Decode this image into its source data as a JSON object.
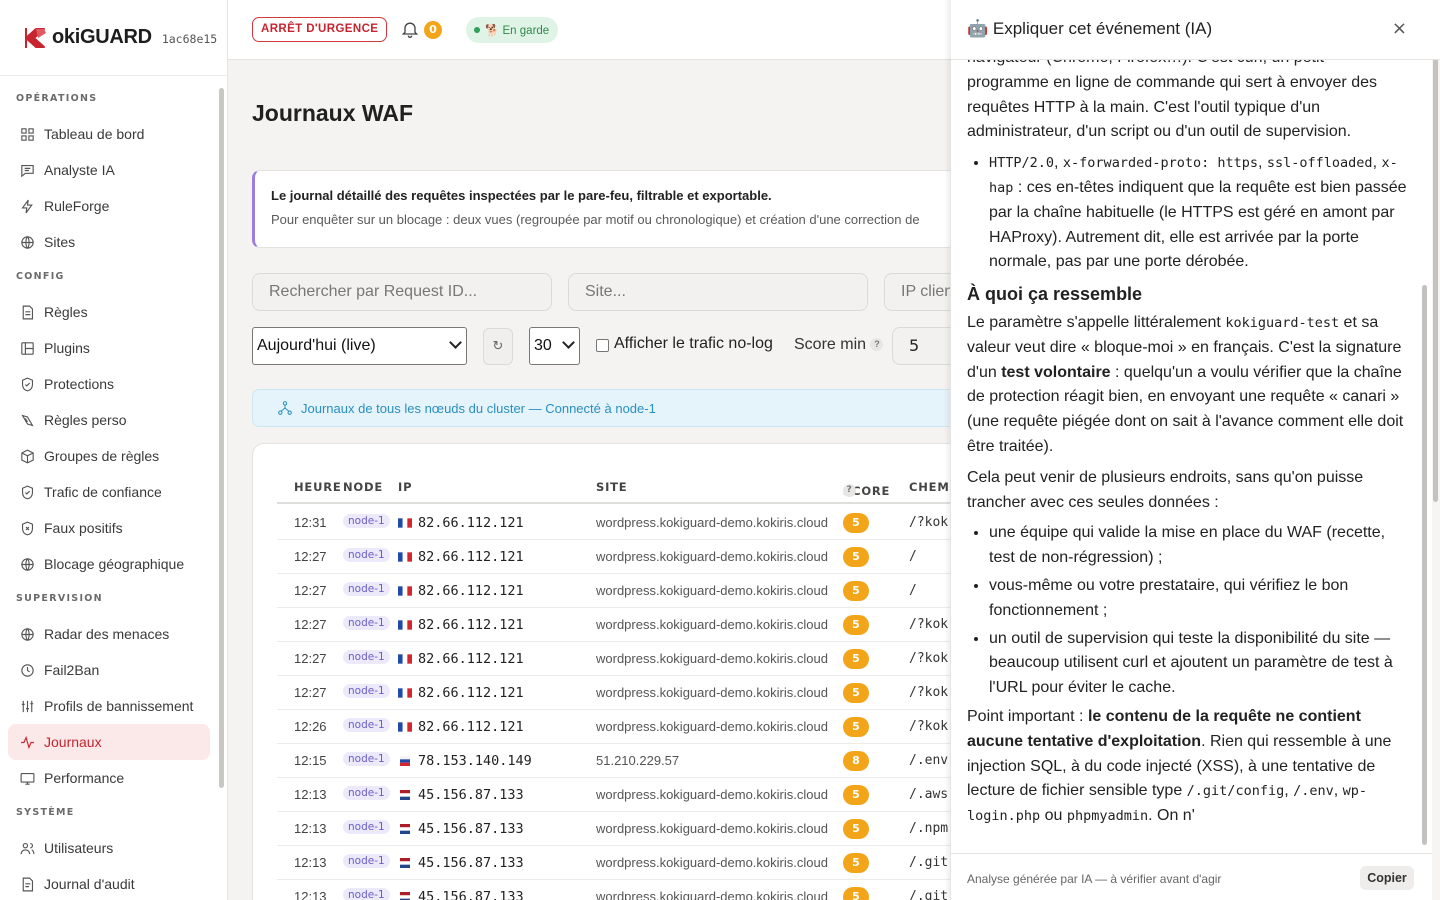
{
  "brand": {
    "name": "okiGUARD",
    "hash": "1ac68e15",
    "accent": "#c8242f"
  },
  "sidebar": {
    "sections": [
      {
        "title": "OPÉRATIONS",
        "items": [
          {
            "label": "Tableau de bord",
            "icon": "dashboard-icon"
          },
          {
            "label": "Analyste IA",
            "icon": "chat-icon"
          },
          {
            "label": "RuleForge",
            "icon": "bolt-icon"
          },
          {
            "label": "Sites",
            "icon": "globe-icon"
          }
        ]
      },
      {
        "title": "CONFIG",
        "items": [
          {
            "label": "Règles",
            "icon": "document-icon"
          },
          {
            "label": "Plugins",
            "icon": "plugin-icon"
          },
          {
            "label": "Protections",
            "icon": "shield-check-icon"
          },
          {
            "label": "Règles perso",
            "icon": "edit-rule-icon"
          },
          {
            "label": "Groupes de règles",
            "icon": "cube-icon"
          },
          {
            "label": "Trafic de confiance",
            "icon": "shield-icon"
          },
          {
            "label": "Faux positifs",
            "icon": "shield-x-icon"
          },
          {
            "label": "Blocage géographique",
            "icon": "globe-icon"
          }
        ]
      },
      {
        "title": "SUPERVISION",
        "items": [
          {
            "label": "Radar des menaces",
            "icon": "radar-icon"
          },
          {
            "label": "Fail2Ban",
            "icon": "clock-icon"
          },
          {
            "label": "Profils de bannissement",
            "icon": "sliders-icon"
          },
          {
            "label": "Journaux",
            "icon": "activity-icon",
            "active": true
          },
          {
            "label": "Performance",
            "icon": "monitor-icon"
          }
        ]
      },
      {
        "title": "SYSTÈME",
        "items": [
          {
            "label": "Utilisateurs",
            "icon": "users-icon"
          },
          {
            "label": "Journal d'audit",
            "icon": "audit-icon"
          }
        ]
      }
    ]
  },
  "topbar": {
    "emergency": "ARRÊT D'URGENCE",
    "notif_count": "0",
    "guard_status": "🐕 En garde"
  },
  "page": {
    "title": "Journaux WAF",
    "intro_title": "Le journal détaillé des requêtes inspectées par le pare-feu, filtrable et exportable.",
    "intro_text": "Pour enquêter sur un blocage : deux vues (regroupée par motif ou chronologique) et création d'une correction de",
    "filters": {
      "request_id_placeholder": "Rechercher par Request ID...",
      "site_placeholder": "Site...",
      "ip_placeholder": "IP client",
      "period": "Aujourd'hui (live)",
      "refresh": "↻",
      "limit": "30",
      "nolog_label": "Afficher le trafic no-log",
      "score_label": "Score min",
      "score_help": "?",
      "score_value": "5"
    },
    "cluster_banner": "Journaux de tous les nœuds du cluster — Connecté à node-1",
    "table": {
      "headers": {
        "time": "HEURE",
        "node": "NODE",
        "ip": "IP",
        "site": "SITE",
        "score": "SCORE",
        "path": "CHEMIN"
      },
      "rows": [
        {
          "time": "12:31",
          "node": "node-1",
          "flag": "fr",
          "ip": "82.66.112.121",
          "site": "wordpress.kokiguard-demo.kokiris.cloud",
          "score": "5",
          "path": "/?kok"
        },
        {
          "time": "12:27",
          "node": "node-1",
          "flag": "fr",
          "ip": "82.66.112.121",
          "site": "wordpress.kokiguard-demo.kokiris.cloud",
          "score": "5",
          "path": "/"
        },
        {
          "time": "12:27",
          "node": "node-1",
          "flag": "fr",
          "ip": "82.66.112.121",
          "site": "wordpress.kokiguard-demo.kokiris.cloud",
          "score": "5",
          "path": "/"
        },
        {
          "time": "12:27",
          "node": "node-1",
          "flag": "fr",
          "ip": "82.66.112.121",
          "site": "wordpress.kokiguard-demo.kokiris.cloud",
          "score": "5",
          "path": "/?kok"
        },
        {
          "time": "12:27",
          "node": "node-1",
          "flag": "fr",
          "ip": "82.66.112.121",
          "site": "wordpress.kokiguard-demo.kokiris.cloud",
          "score": "5",
          "path": "/?kok"
        },
        {
          "time": "12:27",
          "node": "node-1",
          "flag": "fr",
          "ip": "82.66.112.121",
          "site": "wordpress.kokiguard-demo.kokiris.cloud",
          "score": "5",
          "path": "/?kok"
        },
        {
          "time": "12:26",
          "node": "node-1",
          "flag": "fr",
          "ip": "82.66.112.121",
          "site": "wordpress.kokiguard-demo.kokiris.cloud",
          "score": "5",
          "path": "/?kok"
        },
        {
          "time": "12:15",
          "node": "node-1",
          "flag": "ru",
          "ip": "78.153.140.149",
          "site": "51.210.229.57",
          "score": "8",
          "path": "/.env"
        },
        {
          "time": "12:13",
          "node": "node-1",
          "flag": "nl",
          "ip": "45.156.87.133",
          "site": "wordpress.kokiguard-demo.kokiris.cloud",
          "score": "5",
          "path": "/.aws"
        },
        {
          "time": "12:13",
          "node": "node-1",
          "flag": "nl",
          "ip": "45.156.87.133",
          "site": "wordpress.kokiguard-demo.kokiris.cloud",
          "score": "5",
          "path": "/.npm"
        },
        {
          "time": "12:13",
          "node": "node-1",
          "flag": "nl",
          "ip": "45.156.87.133",
          "site": "wordpress.kokiguard-demo.kokiris.cloud",
          "score": "5",
          "path": "/.git"
        },
        {
          "time": "12:13",
          "node": "node-1",
          "flag": "nl",
          "ip": "45.156.87.133",
          "site": "wordpress.kokiguard-demo.kokiris.cloud",
          "score": "5",
          "path": "/.git"
        }
      ]
    }
  },
  "panel": {
    "title": "🤖 Expliquer cet événement (IA)",
    "close": "×",
    "p1": "navigateur (Chrome, Firefox…). C'est curl, un petit programme en ligne de commande qui sert à envoyer des requêtes HTTP à la main. C'est l'outil typique d'un administrateur, d'un script ou d'un outil de supervision.",
    "bullet_http_code": "HTTP/2.0",
    "bullet_http_code2": "x-forwarded-proto: https",
    "bullet_http_code3": "ssl-offloaded",
    "bullet_http_code4": "x-hap",
    "bullet_http_text": " : ces en-têtes indiquent que la requête est bien passée par la chaîne habituelle (le HTTPS est géré en amont par HAProxy). Autrement dit, elle est arrivée par la porte normale, pas par une porte dérobée.",
    "h_resemble": "À quoi ça ressemble",
    "p2_a": "Le paramètre s'appelle littéralement ",
    "p2_code": "kokiguard-test",
    "p2_b": " et sa valeur veut dire « bloque-moi » en français. C'est la signature d'un ",
    "p2_strong": "test volontaire",
    "p2_c": " : quelqu'un a voulu vérifier que la chaîne de protection réagit bien, en envoyant une requête « canari » (une requête piégée dont on sait à l'avance comment elle doit être traitée).",
    "p3": "Cela peut venir de plusieurs endroits, sans qu'on puisse trancher avec ces seules données :",
    "list": [
      "une équipe qui valide la mise en place du WAF (recette, test de non-régression) ;",
      "vous-même ou votre prestataire, qui vérifiez le bon fonctionnement ;",
      "un outil de supervision qui teste la disponibilité du site — beaucoup utilisent curl et ajoutent un paramètre de test à l'URL pour éviter le cache."
    ],
    "p4_a": "Point important : ",
    "p4_strong": "le contenu de la requête ne contient aucune tentative d'exploitation",
    "p4_b": ". Rien qui ressemble à une injection SQL, à du code injecté (XSS), à une tentative de lecture de fichier sensible type ",
    "p4_code1": "/.git/config",
    "p4_code2": "/.env",
    "p4_code3": "wp-login.php",
    "p4_code4": "phpmyadmin",
    "p4_c": ". On n'",
    "footer_note": "Analyse générée par IA — à vérifier avant d'agir",
    "copy": "Copier"
  }
}
